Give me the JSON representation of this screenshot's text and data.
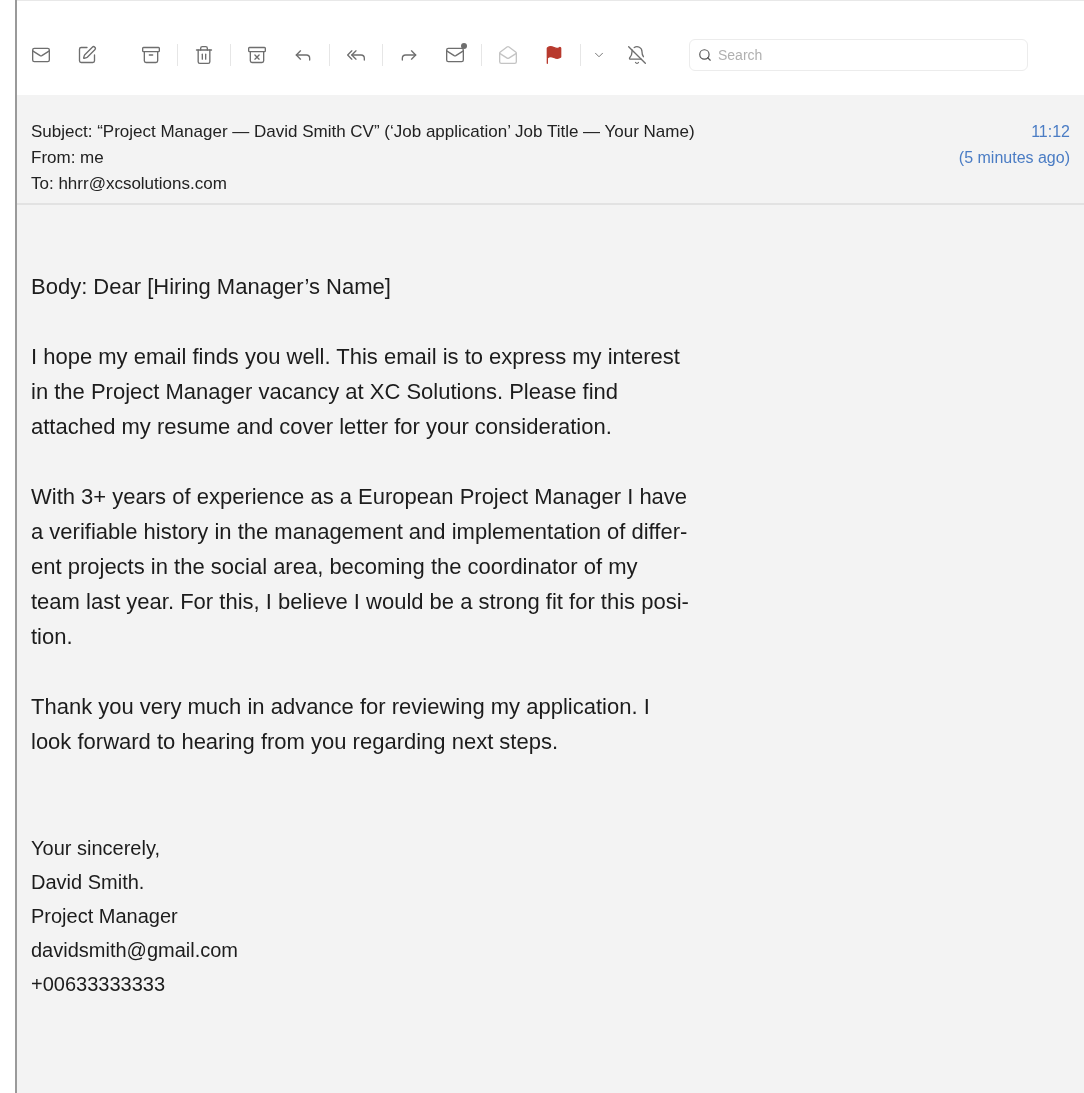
{
  "toolbar": {
    "groups": [
      {
        "buttons": [
          {
            "kind": "mail",
            "disabled": false
          }
        ]
      },
      {
        "buttons": [
          {
            "kind": "compose",
            "disabled": false
          }
        ]
      },
      {
        "buttons": [
          {
            "kind": "archive",
            "disabled": false
          },
          {
            "kind": "trash",
            "disabled": false
          },
          {
            "kind": "junk",
            "disabled": false
          }
        ]
      },
      {
        "buttons": [
          {
            "kind": "reply",
            "disabled": false
          },
          {
            "kind": "reply_all",
            "disabled": false
          },
          {
            "kind": "forward",
            "disabled": false
          }
        ]
      },
      {
        "buttons": [
          {
            "kind": "unread",
            "disabled": false
          },
          {
            "kind": "read",
            "disabled": true
          }
        ]
      },
      {
        "buttons": [
          {
            "kind": "flag",
            "disabled": false,
            "color": "#b83a2e"
          },
          {
            "kind": "menu",
            "disabled": false
          }
        ]
      },
      {
        "buttons": [
          {
            "kind": "mute",
            "disabled": false
          }
        ]
      }
    ],
    "search": {
      "placeholder": "Search"
    }
  },
  "header": {
    "subject": "Subject: “Project Manager — David Smith CV” (‘Job application’ Job Title — Your Name)",
    "from": "From: me",
    "to": "To: hhrr@xcsolutions.com",
    "time": "11:12",
    "relative_time": "(5 minutes ago)"
  },
  "body": {
    "paragraphs": [
      {
        "lines": [
          "Body: Dear [Hiring Manager’s Name]"
        ]
      },
      {
        "lines": [
          "I hope my email finds you well. This email is to express my interest",
          "in the Project Manager vacancy at XC Solutions. Please find",
          "attached my resume and cover letter for your consideration."
        ]
      },
      {
        "lines": [
          "With 3+ years of experience as a European Project Manager I have",
          "a verifiable history in the management and implementation of differ-",
          "ent projects in the social area, becoming the coordinator of my",
          "team last year. For this, I believe I would be a strong fit for this posi-",
          "tion."
        ]
      },
      {
        "lines": [
          "Thank you very much in advance for reviewing my application. I",
          "look forward to hearing from you regarding next steps."
        ]
      }
    ],
    "signature": [
      "Your sincerely,",
      "David Smith.",
      "Project Manager",
      "davidsmith@gmail.com",
      "+00633333333"
    ]
  }
}
